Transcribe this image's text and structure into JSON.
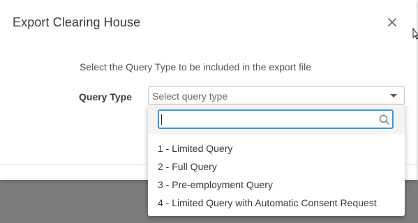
{
  "dialog": {
    "title": "Export Clearing House",
    "instruction": "Select the Query Type to be included in the export file",
    "query_type_label": "Query Type",
    "query_type_placeholder": "Select query type"
  },
  "dropdown": {
    "search_value": "",
    "options": [
      {
        "label": "1 - Limited Query"
      },
      {
        "label": "2 - Full Query"
      },
      {
        "label": "3 - Pre-employment Query"
      },
      {
        "label": "4 - Limited Query with Automatic Consent Request"
      }
    ]
  },
  "colors": {
    "focus_border": "#3b99d8",
    "overlay": "#7f7f7f",
    "text": "#3a3a3a"
  },
  "icons": {
    "close": "close-icon",
    "dropdown_arrow": "caret-down-icon",
    "search": "search-icon"
  }
}
